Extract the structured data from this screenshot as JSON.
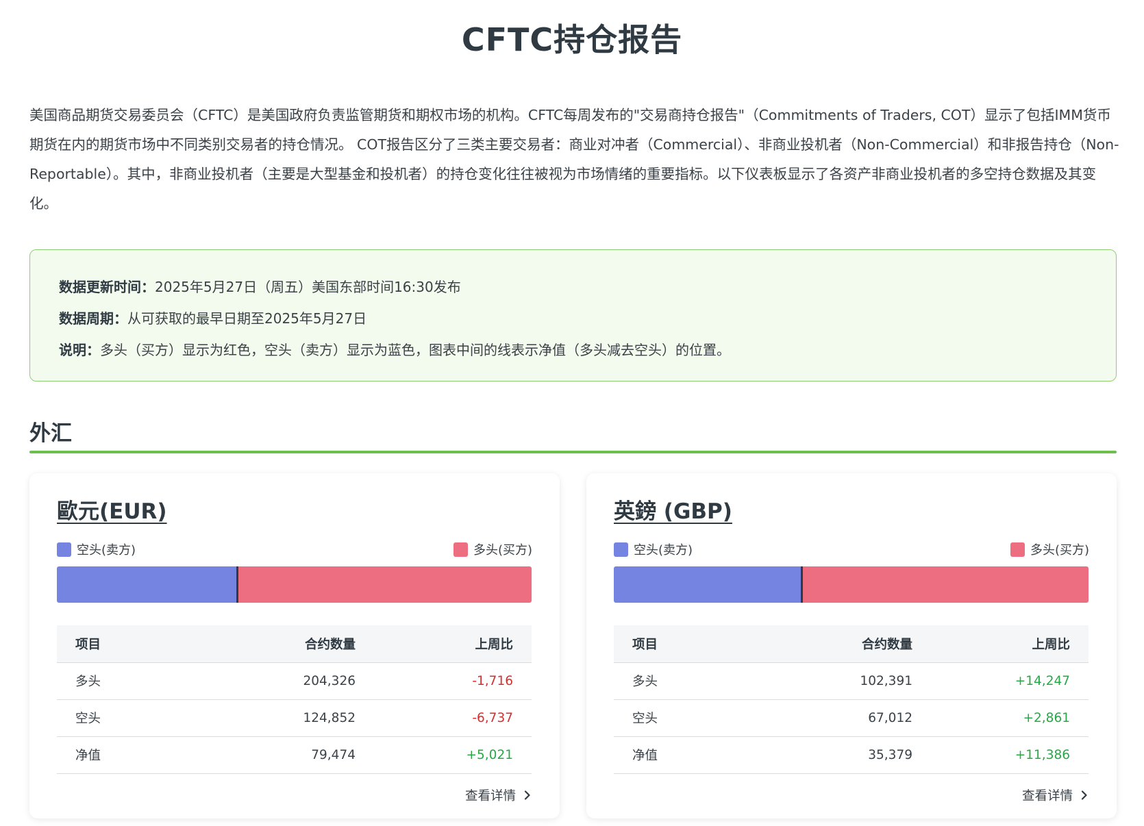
{
  "page_title": "CFTC持仓报告",
  "intro": "美国商品期货交易委员会（CFTC）是美国政府负责监管期货和期权市场的机构。CFTC每周发布的\"交易商持仓报告\"（Commitments of Traders, COT）显示了包括IMM货币期货在内的期货市场中不同类别交易者的持仓情况。 COT报告区分了三类主要交易者：商业对冲者（Commercial）、非商业投机者（Non-Commercial）和非报告持仓（Non-Reportable）。其中，非商业投机者（主要是大型基金和投机者）的持仓变化往往被视为市场情绪的重要指标。以下仪表板显示了各资产非商业投机者的多空持仓数据及其变化。",
  "info": {
    "update_label": "数据更新时间：",
    "update_value": "2025年5月27日（周五）美国东部时间16:30发布",
    "period_label": "数据周期：",
    "period_value": "从可获取的最早日期至2025年5月27日",
    "note_label": "说明：",
    "note_value": "多头（买方）显示为红色，空头（卖方）显示为蓝色，图表中间的线表示净值（多头减去空头）的位置。"
  },
  "section_title": "外汇",
  "colors": {
    "short": "#7484e0",
    "long": "#ec6e80",
    "accent": "#6cbf4c",
    "negative": "#d3302f",
    "positive": "#27a844"
  },
  "legend": {
    "short": "空头(卖方)",
    "long": "多头(买方)"
  },
  "table_headers": {
    "item": "项目",
    "contracts": "合约数量",
    "wow": "上周比"
  },
  "detail_label": "查看详情",
  "cards": [
    {
      "title": "歐元(EUR)",
      "long": 204326,
      "short": 124852,
      "rows": [
        {
          "item": "多头",
          "contracts": "204,326",
          "change": "-1,716",
          "dir": "neg"
        },
        {
          "item": "空头",
          "contracts": "124,852",
          "change": "-6,737",
          "dir": "neg"
        },
        {
          "item": "净值",
          "contracts": "79,474",
          "change": "+5,021",
          "dir": "pos"
        }
      ]
    },
    {
      "title": "英鎊 (GBP)",
      "long": 102391,
      "short": 67012,
      "rows": [
        {
          "item": "多头",
          "contracts": "102,391",
          "change": "+14,247",
          "dir": "pos"
        },
        {
          "item": "空头",
          "contracts": "67,012",
          "change": "+2,861",
          "dir": "pos"
        },
        {
          "item": "净值",
          "contracts": "35,379",
          "change": "+11,386",
          "dir": "pos"
        }
      ]
    }
  ]
}
